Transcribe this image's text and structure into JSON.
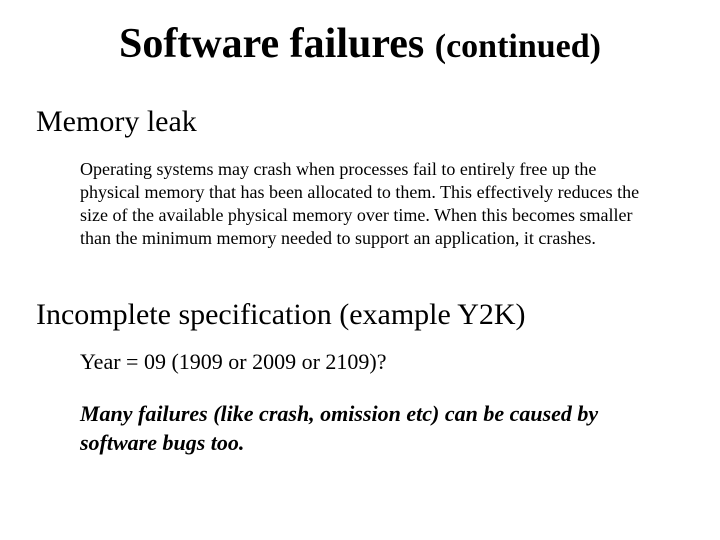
{
  "title": {
    "main": "Software failures ",
    "sub": "(continued)"
  },
  "sections": {
    "memory": {
      "heading": "Memory leak",
      "body": "Operating systems may crash when processes fail to entirely free up the physical memory that has been allocated to them. This effectively reduces the size of the available physical memory over time. When this becomes smaller than the minimum memory needed to support an application, it crashes."
    },
    "spec": {
      "heading": "Incomplete specification (example Y2K)",
      "year_line": "Year = 09 (1909 or 2009 or 2109)?",
      "conclusion": "Many failures (like crash, omission etc) can be caused by software bugs too."
    }
  }
}
